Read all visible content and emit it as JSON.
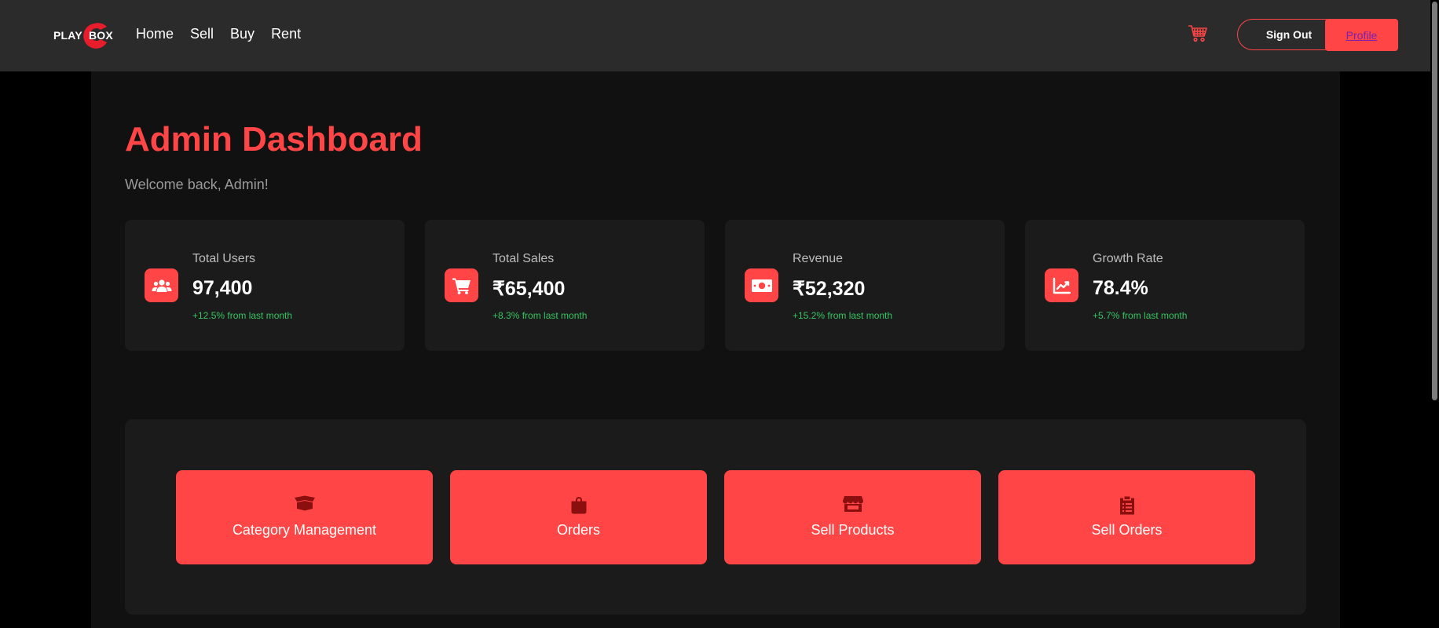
{
  "navbar": {
    "logo": {
      "left": "PLAY",
      "right": "BOX"
    },
    "links": [
      "Home",
      "Sell",
      "Buy",
      "Rent"
    ],
    "cart_icon": "shopping-cart-icon",
    "signout_label": "Sign Out",
    "profile_label": "Profile"
  },
  "page": {
    "title": "Admin Dashboard",
    "subtitle": "Welcome back, Admin!"
  },
  "stats": [
    {
      "label": "Total Users",
      "value": "97,400",
      "change": "+12.5% from last month",
      "icon": "users-icon"
    },
    {
      "label": "Total Sales",
      "value": "₹65,400",
      "change": "+8.3% from last month",
      "icon": "shopping-cart-icon"
    },
    {
      "label": "Revenue",
      "value": "₹52,320",
      "change": "+15.2% from last month",
      "icon": "money-bill-icon"
    },
    {
      "label": "Growth Rate",
      "value": "78.4%",
      "change": "+5.7% from last month",
      "icon": "chart-line-icon"
    }
  ],
  "actions": [
    {
      "label": "Category Management",
      "icon": "box-open-icon"
    },
    {
      "label": "Orders",
      "icon": "shopping-bag-icon"
    },
    {
      "label": "Sell Products",
      "icon": "store-icon"
    },
    {
      "label": "Sell Orders",
      "icon": "clipboard-list-icon"
    }
  ],
  "colors": {
    "accent": "#ff4545",
    "navbar_bg": "#2b2b2b",
    "page_bg": "#000000",
    "main_bg": "#111111",
    "card_bg": "#1b1b1b",
    "positive": "#36c462",
    "action_icon": "#8b0f0f"
  }
}
